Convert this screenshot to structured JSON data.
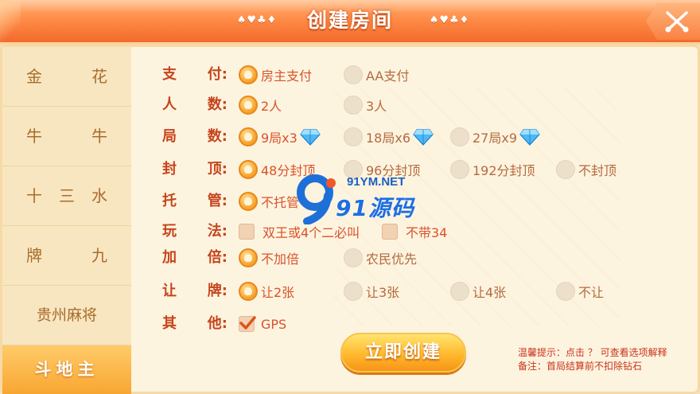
{
  "header": {
    "title": "创建房间",
    "suits_left": "♠♥♣♦",
    "suits_right": "♠♥♣♦",
    "close_icon": "close-x-icon"
  },
  "sidebar": {
    "items": [
      {
        "chars": [
          "金",
          "花"
        ]
      },
      {
        "chars": [
          "牛",
          "牛"
        ]
      },
      {
        "chars": [
          "十",
          "三",
          "水"
        ]
      },
      {
        "chars": [
          "牌",
          "九"
        ]
      },
      {
        "label": "贵州麻将"
      },
      {
        "label": "斗地主",
        "active": true
      }
    ]
  },
  "rows": [
    {
      "label": [
        "支",
        "付:"
      ],
      "options": [
        {
          "text": "房主支付",
          "selected": true
        },
        {
          "text": "AA支付",
          "selected": false
        }
      ]
    },
    {
      "label": [
        "人",
        "数:"
      ],
      "options": [
        {
          "text": "2人",
          "selected": true
        },
        {
          "text": "3人",
          "selected": false
        }
      ]
    },
    {
      "label": [
        "局",
        "数:"
      ],
      "options": [
        {
          "text": "9局x3",
          "selected": true,
          "icon": "diamond-icon"
        },
        {
          "text": "18局x6",
          "selected": false,
          "icon": "diamond-icon"
        },
        {
          "text": "27局x9",
          "selected": false,
          "icon": "diamond-icon"
        }
      ]
    },
    {
      "label": [
        "封",
        "顶:"
      ],
      "options": [
        {
          "text": "48分封顶",
          "selected": true
        },
        {
          "text": "96分封顶",
          "selected": false
        },
        {
          "text": "192分封顶",
          "selected": false
        },
        {
          "text": "不封顶",
          "selected": false
        }
      ]
    },
    {
      "label": [
        "托",
        "管:"
      ],
      "options": [
        {
          "text": "不托管",
          "selected": true
        }
      ]
    },
    {
      "label": [
        "玩",
        "法:"
      ],
      "options": [
        {
          "text": "双王或4个二必叫",
          "checkbox": true,
          "checked": false
        },
        {
          "text": "不带34",
          "checkbox": true,
          "checked": false
        }
      ]
    },
    {
      "label": [
        "加",
        "倍:"
      ],
      "options": [
        {
          "text": "不加倍",
          "selected": true
        },
        {
          "text": "农民优先",
          "selected": false
        }
      ]
    },
    {
      "label": [
        "让",
        "牌:"
      ],
      "options": [
        {
          "text": "让2张",
          "selected": true
        },
        {
          "text": "让3张",
          "selected": false
        },
        {
          "text": "让4张",
          "selected": false
        },
        {
          "text": "不让",
          "selected": false
        }
      ]
    },
    {
      "label": [
        "其",
        "他:"
      ],
      "options": [
        {
          "text": "GPS",
          "checkbox": true,
          "checked": true
        }
      ]
    }
  ],
  "create_button": "立即创建",
  "hints": {
    "line1": "温馨提示：点击 ？ 可查看选项解释",
    "line2": "备注：首局结算前不扣除钻石"
  },
  "watermark": {
    "url": "91YM.NET",
    "name": "91源码"
  },
  "colors": {
    "accent": "#f6a127",
    "label": "#c6451d",
    "header": "#ff8a46"
  }
}
